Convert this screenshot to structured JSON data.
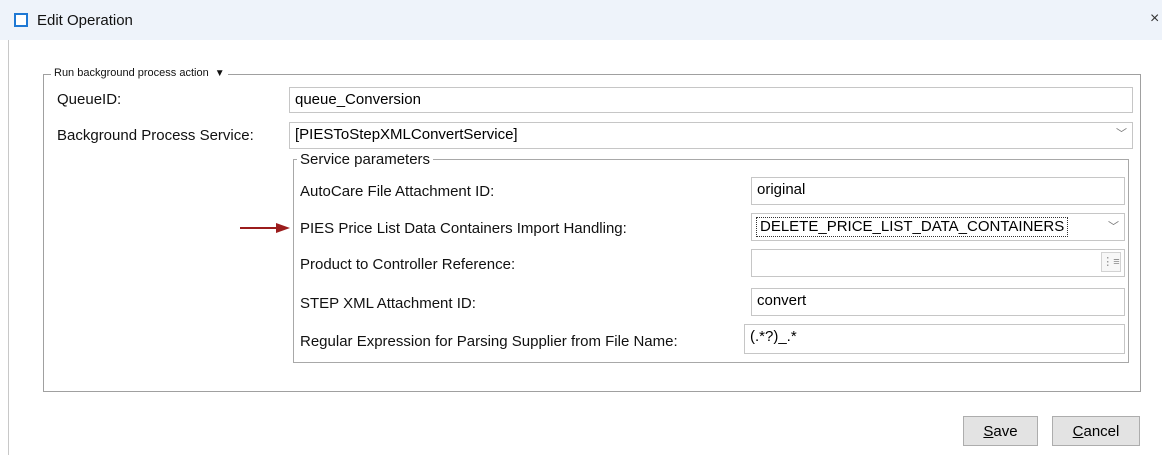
{
  "window": {
    "title": "Edit Operation",
    "close_glyph": "×"
  },
  "action_group": {
    "legend": "Run background process action"
  },
  "queue": {
    "label": "QueueID:",
    "value": "queue_Conversion"
  },
  "service": {
    "label": "Background Process Service:",
    "value": "[PIESToStepXMLConvertService]"
  },
  "service_params": {
    "legend": "Service parameters",
    "rows": [
      {
        "label": "AutoCare File Attachment ID:",
        "value": "original"
      },
      {
        "label": "PIES Price List Data Containers Import Handling:",
        "value": "DELETE_PRICE_LIST_DATA_CONTAINERS"
      },
      {
        "label": "Product to Controller Reference:",
        "value": ""
      },
      {
        "label": "STEP XML Attachment ID:",
        "value": "convert"
      },
      {
        "label": "Regular Expression for Parsing Supplier from File Name:",
        "value": "(.*?)_.*"
      }
    ]
  },
  "buttons": {
    "save_first": "S",
    "save_rest": "ave",
    "cancel_first": "C",
    "cancel_rest": "ancel"
  },
  "colors": {
    "arrow": "#9b1c1c",
    "title_icon": "#1e78d4"
  },
  "icons": {
    "title": "window-icon",
    "dropdown": "chevron-down-icon",
    "tree": "tree-picker-icon",
    "annotation": "red-arrow-icon"
  }
}
